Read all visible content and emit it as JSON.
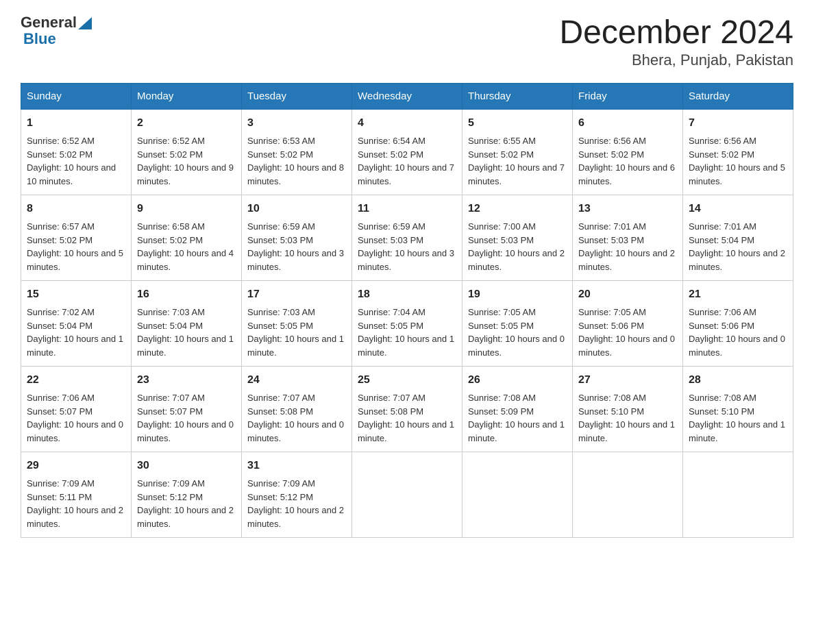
{
  "header": {
    "logo_general": "General",
    "logo_blue": "Blue",
    "title": "December 2024",
    "subtitle": "Bhera, Punjab, Pakistan"
  },
  "calendar": {
    "days_of_week": [
      "Sunday",
      "Monday",
      "Tuesday",
      "Wednesday",
      "Thursday",
      "Friday",
      "Saturday"
    ],
    "weeks": [
      [
        {
          "day": "1",
          "sunrise": "6:52 AM",
          "sunset": "5:02 PM",
          "daylight": "10 hours and 10 minutes."
        },
        {
          "day": "2",
          "sunrise": "6:52 AM",
          "sunset": "5:02 PM",
          "daylight": "10 hours and 9 minutes."
        },
        {
          "day": "3",
          "sunrise": "6:53 AM",
          "sunset": "5:02 PM",
          "daylight": "10 hours and 8 minutes."
        },
        {
          "day": "4",
          "sunrise": "6:54 AM",
          "sunset": "5:02 PM",
          "daylight": "10 hours and 7 minutes."
        },
        {
          "day": "5",
          "sunrise": "6:55 AM",
          "sunset": "5:02 PM",
          "daylight": "10 hours and 7 minutes."
        },
        {
          "day": "6",
          "sunrise": "6:56 AM",
          "sunset": "5:02 PM",
          "daylight": "10 hours and 6 minutes."
        },
        {
          "day": "7",
          "sunrise": "6:56 AM",
          "sunset": "5:02 PM",
          "daylight": "10 hours and 5 minutes."
        }
      ],
      [
        {
          "day": "8",
          "sunrise": "6:57 AM",
          "sunset": "5:02 PM",
          "daylight": "10 hours and 5 minutes."
        },
        {
          "day": "9",
          "sunrise": "6:58 AM",
          "sunset": "5:02 PM",
          "daylight": "10 hours and 4 minutes."
        },
        {
          "day": "10",
          "sunrise": "6:59 AM",
          "sunset": "5:03 PM",
          "daylight": "10 hours and 3 minutes."
        },
        {
          "day": "11",
          "sunrise": "6:59 AM",
          "sunset": "5:03 PM",
          "daylight": "10 hours and 3 minutes."
        },
        {
          "day": "12",
          "sunrise": "7:00 AM",
          "sunset": "5:03 PM",
          "daylight": "10 hours and 2 minutes."
        },
        {
          "day": "13",
          "sunrise": "7:01 AM",
          "sunset": "5:03 PM",
          "daylight": "10 hours and 2 minutes."
        },
        {
          "day": "14",
          "sunrise": "7:01 AM",
          "sunset": "5:04 PM",
          "daylight": "10 hours and 2 minutes."
        }
      ],
      [
        {
          "day": "15",
          "sunrise": "7:02 AM",
          "sunset": "5:04 PM",
          "daylight": "10 hours and 1 minute."
        },
        {
          "day": "16",
          "sunrise": "7:03 AM",
          "sunset": "5:04 PM",
          "daylight": "10 hours and 1 minute."
        },
        {
          "day": "17",
          "sunrise": "7:03 AM",
          "sunset": "5:05 PM",
          "daylight": "10 hours and 1 minute."
        },
        {
          "day": "18",
          "sunrise": "7:04 AM",
          "sunset": "5:05 PM",
          "daylight": "10 hours and 1 minute."
        },
        {
          "day": "19",
          "sunrise": "7:05 AM",
          "sunset": "5:05 PM",
          "daylight": "10 hours and 0 minutes."
        },
        {
          "day": "20",
          "sunrise": "7:05 AM",
          "sunset": "5:06 PM",
          "daylight": "10 hours and 0 minutes."
        },
        {
          "day": "21",
          "sunrise": "7:06 AM",
          "sunset": "5:06 PM",
          "daylight": "10 hours and 0 minutes."
        }
      ],
      [
        {
          "day": "22",
          "sunrise": "7:06 AM",
          "sunset": "5:07 PM",
          "daylight": "10 hours and 0 minutes."
        },
        {
          "day": "23",
          "sunrise": "7:07 AM",
          "sunset": "5:07 PM",
          "daylight": "10 hours and 0 minutes."
        },
        {
          "day": "24",
          "sunrise": "7:07 AM",
          "sunset": "5:08 PM",
          "daylight": "10 hours and 0 minutes."
        },
        {
          "day": "25",
          "sunrise": "7:07 AM",
          "sunset": "5:08 PM",
          "daylight": "10 hours and 1 minute."
        },
        {
          "day": "26",
          "sunrise": "7:08 AM",
          "sunset": "5:09 PM",
          "daylight": "10 hours and 1 minute."
        },
        {
          "day": "27",
          "sunrise": "7:08 AM",
          "sunset": "5:10 PM",
          "daylight": "10 hours and 1 minute."
        },
        {
          "day": "28",
          "sunrise": "7:08 AM",
          "sunset": "5:10 PM",
          "daylight": "10 hours and 1 minute."
        }
      ],
      [
        {
          "day": "29",
          "sunrise": "7:09 AM",
          "sunset": "5:11 PM",
          "daylight": "10 hours and 2 minutes."
        },
        {
          "day": "30",
          "sunrise": "7:09 AM",
          "sunset": "5:12 PM",
          "daylight": "10 hours and 2 minutes."
        },
        {
          "day": "31",
          "sunrise": "7:09 AM",
          "sunset": "5:12 PM",
          "daylight": "10 hours and 2 minutes."
        },
        null,
        null,
        null,
        null
      ]
    ]
  }
}
